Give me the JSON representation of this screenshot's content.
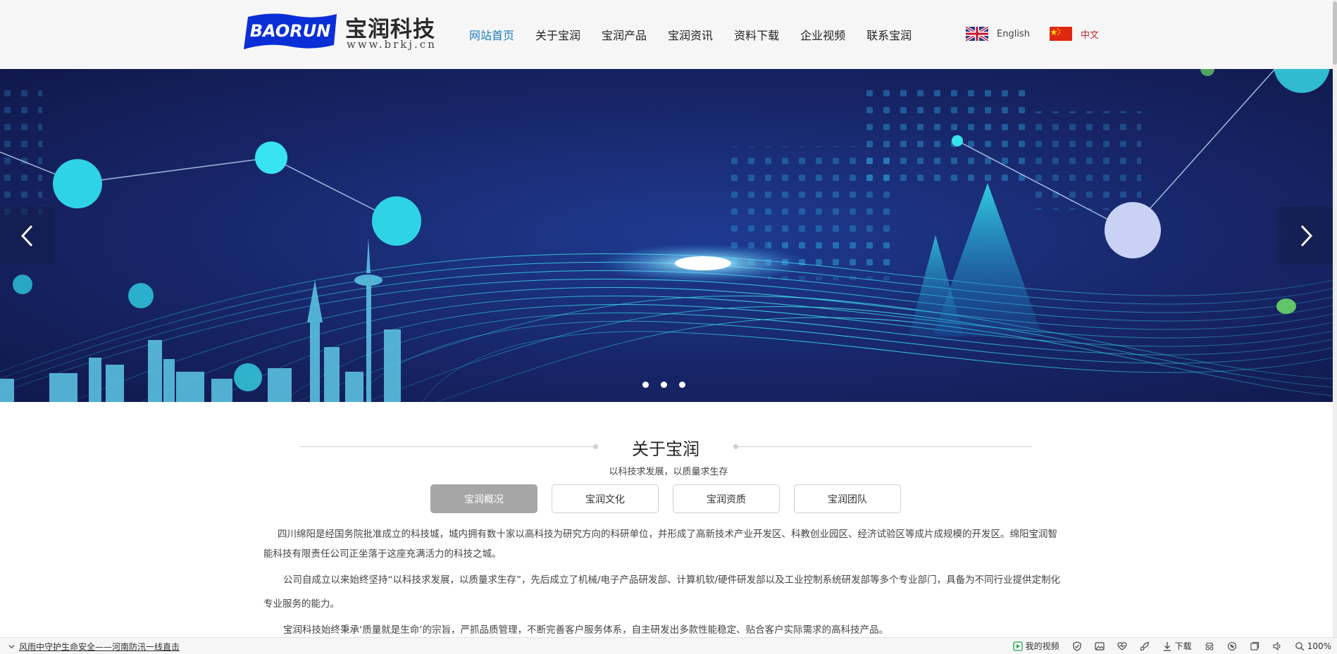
{
  "header": {
    "logo_badge": "BAORUN",
    "logo_cn": "宝润科技",
    "logo_url": "www.brkj.cn"
  },
  "nav": {
    "items": [
      {
        "label": "网站首页",
        "active": true
      },
      {
        "label": "关于宝润"
      },
      {
        "label": "宝润产品"
      },
      {
        "label": "宝润资讯"
      },
      {
        "label": "资料下载"
      },
      {
        "label": "企业视频"
      },
      {
        "label": "联系宝润"
      }
    ],
    "active_color": "#1f7fc1"
  },
  "lang": {
    "english": "English",
    "chinese": "中文"
  },
  "banner": {
    "icons": {
      "prev": "chevron-left-icon",
      "next": "chevron-right-icon"
    },
    "slide_count": 3
  },
  "about": {
    "title": "关于宝润",
    "subtitle": "以科技求发展，以质量求生存",
    "tabs": [
      "宝润概况",
      "宝润文化",
      "宝润资质",
      "宝润团队"
    ],
    "active_tab": 0,
    "paragraphs": [
      "四川绵阳是经国务院批准成立的科技城，城内拥有数十家以高科技为研究方向的科研单位，并形成了高新技术产业开发区、科教创业园区、经济试验区等成片成规模的开发区。绵阳宝润智能科技有限责任公司正坐落于这座充满活力的科技之城。",
      "公司自成立以来始终坚持“以科技求发展，以质量求生存”，先后成立了机械/电子产品研发部、计算机软/硬件研发部以及工业控制系统研发部等多个专业部门，具备为不同行业提供定制化专业服务的能力。",
      "宝润科技始终秉承‘质量就是生命’的宗旨，严抓品质管理，不断完善客户服务体系，自主研发出多款性能稳定、贴合客户实际需求的高科技产品。"
    ]
  },
  "statusbar": {
    "news": "风雨中守护生命安全——河南防汛一线直击",
    "my_video": "我的视频",
    "download": "下载",
    "zoom": "100%"
  },
  "colors": {
    "brand_blue": "#0b2fd6",
    "banner_dark": "#141a52",
    "accent_cyan": "#2fd3e6"
  }
}
